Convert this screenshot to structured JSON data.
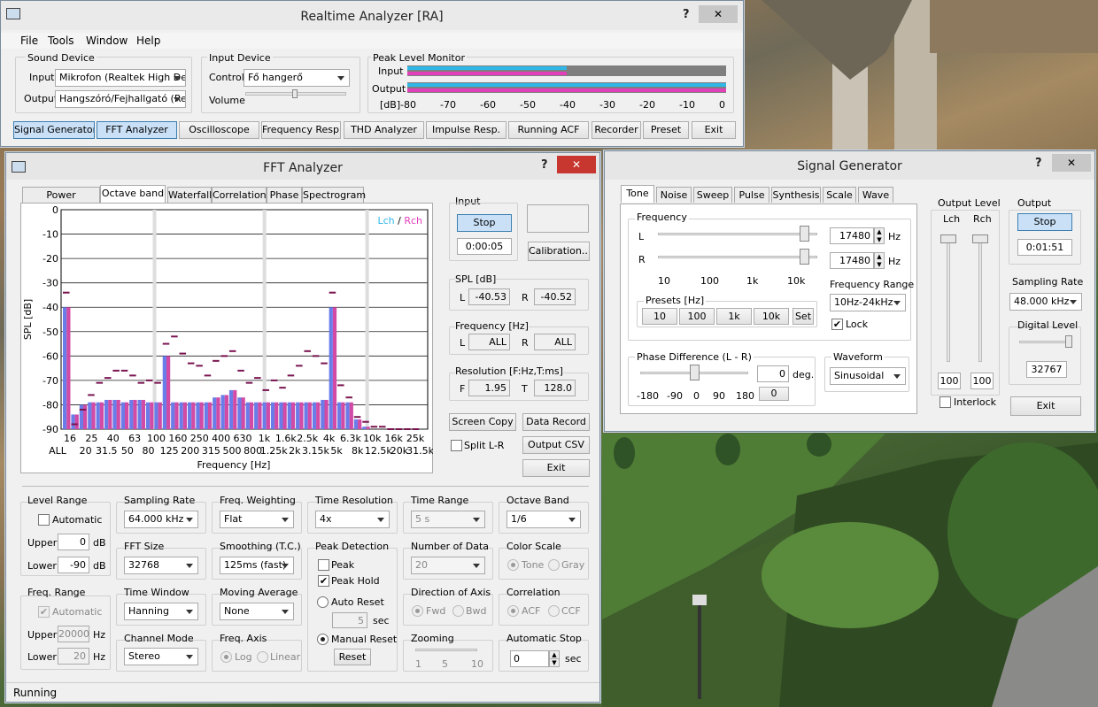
{
  "ra": {
    "title": "Realtime Analyzer [RA]",
    "help": "?",
    "close": "✕",
    "menu": [
      "File",
      "Tools",
      "Window",
      "Help"
    ],
    "sound_device": {
      "title": "Sound Device",
      "input_label": "Input",
      "input_value": "Mikrofon (Realtek High De",
      "output_label": "Output",
      "output_value": "Hangszóró/Fejhallgató (Re"
    },
    "input_device": {
      "title": "Input Device",
      "control_label": "Control",
      "control_value": "Fő hangerő",
      "volume_label": "Volume",
      "volume_level": 0.58
    },
    "peak": {
      "title": "Peak Level Monitor",
      "input_label": "Input",
      "output_label": "Output",
      "db_label": "[dB]",
      "ticks": [
        "-80",
        "-70",
        "-60",
        "-50",
        "-40",
        "-30",
        "-20",
        "-10",
        "0"
      ],
      "input_level_db": -40,
      "output_level_db": 0,
      "colors": {
        "lch": "#2fb7e8",
        "rch": "#e23fbb"
      }
    },
    "buttons": [
      "Signal Generator",
      "FFT Analyzer",
      "Oscilloscope",
      "Frequency Resp.",
      "THD Analyzer",
      "Impulse Resp.",
      "Running ACF",
      "Recorder",
      "Preset",
      "Exit"
    ]
  },
  "fft": {
    "title": "FFT Analyzer",
    "help": "?",
    "close": "✕",
    "tabs": [
      "Power Spectrum",
      "Octave band",
      "Waterfall",
      "Correlation",
      "Phase",
      "Spectrogram"
    ],
    "input": {
      "title": "Input",
      "stop": "Stop",
      "time": "0:00:05",
      "calibration": "Calibration..."
    },
    "spl": {
      "title": "SPL [dB]",
      "l_label": "L",
      "l_value": "-40.53",
      "r_label": "R",
      "r_value": "-40.52"
    },
    "freq": {
      "title": "Frequency [Hz]",
      "l_label": "L",
      "l_value": "ALL",
      "r_label": "R",
      "r_value": "ALL"
    },
    "res": {
      "title": "Resolution [F:Hz,T:ms]",
      "f_label": "F",
      "f_value": "1.95",
      "t_label": "T",
      "t_value": "128.0"
    },
    "screen_copy": "Screen Copy",
    "data_record": "Data Record",
    "split": "Split L-R",
    "output_csv": "Output CSV",
    "exit": "Exit",
    "level_range": {
      "title": "Level Range",
      "automatic": "Automatic",
      "upper_label": "Upper",
      "upper": "0",
      "lower_label": "Lower",
      "lower": "-90",
      "unit": "dB"
    },
    "freq_range": {
      "title": "Freq. Range",
      "automatic": "Automatic",
      "upper_label": "Upper",
      "upper": "20000",
      "lower_label": "Lower",
      "lower": "20",
      "unit": "Hz"
    },
    "sampling": {
      "title": "Sampling Rate",
      "value": "64.000 kHz"
    },
    "fft_size": {
      "title": "FFT Size",
      "value": "32768"
    },
    "time_window": {
      "title": "Time Window",
      "value": "Hanning"
    },
    "channel_mode": {
      "title": "Channel Mode",
      "value": "Stereo"
    },
    "freq_weight": {
      "title": "Freq. Weighting",
      "value": "Flat"
    },
    "smoothing": {
      "title": "Smoothing (T.C.)",
      "value": "125ms (fast)"
    },
    "moving_avg": {
      "title": "Moving Average",
      "value": "None"
    },
    "freq_axis": {
      "title": "Freq. Axis",
      "log": "Log",
      "linear": "Linear"
    },
    "time_res": {
      "title": "Time Resolution",
      "value": "4x"
    },
    "peak_det": {
      "title": "Peak Detection",
      "peak": "Peak",
      "peak_hold": "Peak Hold",
      "auto_reset": "Auto Reset",
      "sec_value": "5",
      "sec": "sec",
      "manual_reset": "Manual Reset",
      "reset": "Reset"
    },
    "time_range": {
      "title": "Time Range",
      "value": "5 s"
    },
    "num_data": {
      "title": "Number of Data",
      "value": "20"
    },
    "direction": {
      "title": "Direction of Axis",
      "fwd": "Fwd",
      "bwd": "Bwd"
    },
    "zooming": {
      "title": "Zooming",
      "ticks": [
        "1",
        "5",
        "10"
      ]
    },
    "octave": {
      "title": "Octave Band",
      "value": "1/6"
    },
    "color_scale": {
      "title": "Color Scale",
      "tone": "Tone",
      "gray": "Gray"
    },
    "correlation": {
      "title": "Correlation",
      "acf": "ACF",
      "ccf": "CCF"
    },
    "auto_stop": {
      "title": "Automatic Stop",
      "value": "0",
      "unit": "sec"
    },
    "status": "Running"
  },
  "chart_data": {
    "type": "bar",
    "xlabel": "Frequency [Hz]",
    "ylabel": "SPL [dB]",
    "ylim": [
      -90,
      0
    ],
    "yticks": [
      "0",
      "-10",
      "-20",
      "-30",
      "-40",
      "-50",
      "-60",
      "-70",
      "-80",
      "-90"
    ],
    "xticks_top": [
      "16",
      "25",
      "40",
      "63",
      "100",
      "160",
      "250",
      "400",
      "630",
      "1k",
      "1.6k",
      "2.5k",
      "4k",
      "6.3k",
      "10k",
      "16k",
      "25k"
    ],
    "xticks_bottom": [
      "ALL",
      "20",
      "31.5",
      "50",
      "80",
      "125",
      "200",
      "315",
      "500",
      "800",
      "1.25k",
      "2k",
      "3.15k",
      "5k",
      "8k",
      "12.5k",
      "20k",
      "31.5k"
    ],
    "legend": {
      "lch": "Lch",
      "sep": "/",
      "rch": "Rch"
    },
    "legend_position": "top-right",
    "grid": true,
    "series": [
      {
        "name": "Lch",
        "color": "#6a7ce8",
        "values": [
          -40,
          -84,
          -80,
          -79,
          -79,
          -78,
          -78,
          -79,
          -78,
          -78,
          -79,
          -79,
          -60,
          -79,
          -79,
          -79,
          -79,
          -79,
          -77,
          -76,
          -74,
          -77,
          -79,
          -79,
          -79,
          -79,
          -79,
          -79,
          -79,
          -79,
          -79,
          -78,
          -40,
          -79,
          -79,
          -86,
          -89,
          -90,
          -90,
          -90,
          -90,
          -90,
          -90
        ]
      },
      {
        "name": "Rch",
        "color": "#d04aa6",
        "values": [
          -40,
          -84,
          -80,
          -79,
          -79,
          -78,
          -78,
          -79,
          -78,
          -78,
          -79,
          -79,
          -60,
          -79,
          -79,
          -79,
          -79,
          -79,
          -77,
          -76,
          -74,
          -77,
          -79,
          -79,
          -79,
          -79,
          -79,
          -79,
          -79,
          -79,
          -79,
          -78,
          -40,
          -79,
          -79,
          -86,
          -89,
          -90,
          -90,
          -90,
          -90,
          -90,
          -90
        ]
      }
    ],
    "peak_hold": [
      -34,
      -88,
      -82,
      -76,
      -71,
      -69,
      -66,
      -66,
      -68,
      -71,
      -70,
      -71,
      -55,
      -52,
      -59,
      -63,
      -64,
      -68,
      -62,
      -60,
      -58,
      -66,
      -71,
      -69,
      -74,
      -70,
      -73,
      -68,
      -64,
      -58,
      -60,
      -63,
      -34,
      -72,
      -77,
      -85,
      -87,
      -89,
      -89,
      -90,
      -90,
      -90,
      -90
    ]
  },
  "sg": {
    "title": "Signal Generator",
    "help": "?",
    "close": "✕",
    "tabs": [
      "Tone",
      "Noise",
      "Sweep",
      "Pulse",
      "Synthesis",
      "Scale",
      "Wave"
    ],
    "frequency": {
      "title": "Frequency",
      "l_label": "L",
      "r_label": "R",
      "l_value": "17480",
      "r_value": "17480",
      "unit": "Hz",
      "ticks": [
        "10",
        "100",
        "1k",
        "10k"
      ],
      "l_level": 0.97,
      "r_level": 0.97
    },
    "range": {
      "title": "Frequency Range",
      "value": "10Hz-24kHz",
      "lock": "Lock"
    },
    "presets": {
      "title": "Presets [Hz]",
      "items": [
        "10",
        "100",
        "1k",
        "10k"
      ],
      "set": "Set"
    },
    "phase": {
      "title": "Phase Difference (L - R)",
      "value": "0",
      "unit": "deg.",
      "ticks": [
        "-180",
        "-90",
        "0",
        "90",
        "180"
      ],
      "btn": "0",
      "level": 0.5
    },
    "waveform": {
      "title": "Waveform",
      "value": "Sinusoidal"
    },
    "out_level": {
      "title": "Output Level",
      "lch": "Lch",
      "rch": "Rch",
      "l_value": "100",
      "r_value": "100",
      "interlock": "Interlock"
    },
    "output": {
      "title": "Output",
      "stop": "Stop",
      "time": "0:01:51"
    },
    "sampling": {
      "title": "Sampling Rate",
      "value": "48.000 kHz"
    },
    "digital": {
      "title": "Digital Level",
      "value": "32767"
    },
    "exit": "Exit"
  }
}
